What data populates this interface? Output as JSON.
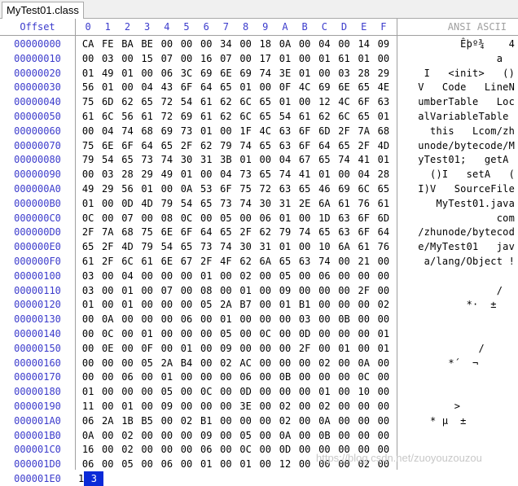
{
  "tab": {
    "title": "MyTest01.class"
  },
  "header": {
    "offset_label": "Offset",
    "columns": [
      "0",
      "1",
      "2",
      "3",
      "4",
      "5",
      "6",
      "7",
      "8",
      "9",
      "A",
      "B",
      "C",
      "D",
      "E",
      "F"
    ],
    "ansi_label": "ANSI ASCII"
  },
  "rows": [
    {
      "offset": "00000000",
      "bytes": [
        "CA",
        "FE",
        "BA",
        "BE",
        "00",
        "00",
        "00",
        "34",
        "00",
        "18",
        "0A",
        "00",
        "04",
        "00",
        "14",
        "09"
      ],
      "ansi": "Êþº¾    4"
    },
    {
      "offset": "00000010",
      "bytes": [
        "00",
        "03",
        "00",
        "15",
        "07",
        "00",
        "16",
        "07",
        "00",
        "17",
        "01",
        "00",
        "01",
        "61",
        "01",
        "00"
      ],
      "ansi": "a  "
    },
    {
      "offset": "00000020",
      "bytes": [
        "01",
        "49",
        "01",
        "00",
        "06",
        "3C",
        "69",
        "6E",
        "69",
        "74",
        "3E",
        "01",
        "00",
        "03",
        "28",
        "29"
      ],
      "ansi": "I   <init>   ()"
    },
    {
      "offset": "00000030",
      "bytes": [
        "56",
        "01",
        "00",
        "04",
        "43",
        "6F",
        "64",
        "65",
        "01",
        "00",
        "0F",
        "4C",
        "69",
        "6E",
        "65",
        "4E"
      ],
      "ansi": "V   Code   LineN"
    },
    {
      "offset": "00000040",
      "bytes": [
        "75",
        "6D",
        "62",
        "65",
        "72",
        "54",
        "61",
        "62",
        "6C",
        "65",
        "01",
        "00",
        "12",
        "4C",
        "6F",
        "63"
      ],
      "ansi": "umberTable   Loc"
    },
    {
      "offset": "00000050",
      "bytes": [
        "61",
        "6C",
        "56",
        "61",
        "72",
        "69",
        "61",
        "62",
        "6C",
        "65",
        "54",
        "61",
        "62",
        "6C",
        "65",
        "01"
      ],
      "ansi": "alVariableTable "
    },
    {
      "offset": "00000060",
      "bytes": [
        "00",
        "04",
        "74",
        "68",
        "69",
        "73",
        "01",
        "00",
        "1F",
        "4C",
        "63",
        "6F",
        "6D",
        "2F",
        "7A",
        "68"
      ],
      "ansi": "this   Lcom/zh"
    },
    {
      "offset": "00000070",
      "bytes": [
        "75",
        "6E",
        "6F",
        "64",
        "65",
        "2F",
        "62",
        "79",
        "74",
        "65",
        "63",
        "6F",
        "64",
        "65",
        "2F",
        "4D"
      ],
      "ansi": "unode/bytecode/M"
    },
    {
      "offset": "00000080",
      "bytes": [
        "79",
        "54",
        "65",
        "73",
        "74",
        "30",
        "31",
        "3B",
        "01",
        "00",
        "04",
        "67",
        "65",
        "74",
        "41",
        "01"
      ],
      "ansi": "yTest01;   getA "
    },
    {
      "offset": "00000090",
      "bytes": [
        "00",
        "03",
        "28",
        "29",
        "49",
        "01",
        "00",
        "04",
        "73",
        "65",
        "74",
        "41",
        "01",
        "00",
        "04",
        "28"
      ],
      "ansi": "()I   setA   ("
    },
    {
      "offset": "000000A0",
      "bytes": [
        "49",
        "29",
        "56",
        "01",
        "00",
        "0A",
        "53",
        "6F",
        "75",
        "72",
        "63",
        "65",
        "46",
        "69",
        "6C",
        "65"
      ],
      "ansi": "I)V   SourceFile"
    },
    {
      "offset": "000000B0",
      "bytes": [
        "01",
        "00",
        "0D",
        "4D",
        "79",
        "54",
        "65",
        "73",
        "74",
        "30",
        "31",
        "2E",
        "6A",
        "61",
        "76",
        "61"
      ],
      "ansi": "MyTest01.java"
    },
    {
      "offset": "000000C0",
      "bytes": [
        "0C",
        "00",
        "07",
        "00",
        "08",
        "0C",
        "00",
        "05",
        "00",
        "06",
        "01",
        "00",
        "1D",
        "63",
        "6F",
        "6D"
      ],
      "ansi": "com"
    },
    {
      "offset": "000000D0",
      "bytes": [
        "2F",
        "7A",
        "68",
        "75",
        "6E",
        "6F",
        "64",
        "65",
        "2F",
        "62",
        "79",
        "74",
        "65",
        "63",
        "6F",
        "64"
      ],
      "ansi": "/zhunode/bytecod"
    },
    {
      "offset": "000000E0",
      "bytes": [
        "65",
        "2F",
        "4D",
        "79",
        "54",
        "65",
        "73",
        "74",
        "30",
        "31",
        "01",
        "00",
        "10",
        "6A",
        "61",
        "76"
      ],
      "ansi": "e/MyTest01   jav"
    },
    {
      "offset": "000000F0",
      "bytes": [
        "61",
        "2F",
        "6C",
        "61",
        "6E",
        "67",
        "2F",
        "4F",
        "62",
        "6A",
        "65",
        "63",
        "74",
        "00",
        "21",
        "00"
      ],
      "ansi": "a/lang/Object !"
    },
    {
      "offset": "00000100",
      "bytes": [
        "03",
        "00",
        "04",
        "00",
        "00",
        "00",
        "01",
        "00",
        "02",
        "00",
        "05",
        "00",
        "06",
        "00",
        "00",
        "00"
      ],
      "ansi": ""
    },
    {
      "offset": "00000110",
      "bytes": [
        "03",
        "00",
        "01",
        "00",
        "07",
        "00",
        "08",
        "00",
        "01",
        "00",
        "09",
        "00",
        "00",
        "00",
        "2F",
        "00"
      ],
      "ansi": "/  "
    },
    {
      "offset": "00000120",
      "bytes": [
        "01",
        "00",
        "01",
        "00",
        "00",
        "00",
        "05",
        "2A",
        "B7",
        "00",
        "01",
        "B1",
        "00",
        "00",
        "00",
        "02"
      ],
      "ansi": "*·  ±   "
    },
    {
      "offset": "00000130",
      "bytes": [
        "00",
        "0A",
        "00",
        "00",
        "00",
        "06",
        "00",
        "01",
        "00",
        "00",
        "00",
        "03",
        "00",
        "0B",
        "00",
        "00"
      ],
      "ansi": ""
    },
    {
      "offset": "00000140",
      "bytes": [
        "00",
        "0C",
        "00",
        "01",
        "00",
        "00",
        "00",
        "05",
        "00",
        "0C",
        "00",
        "0D",
        "00",
        "00",
        "00",
        "01"
      ],
      "ansi": ""
    },
    {
      "offset": "00000150",
      "bytes": [
        "00",
        "0E",
        "00",
        "0F",
        "00",
        "01",
        "00",
        "09",
        "00",
        "00",
        "00",
        "2F",
        "00",
        "01",
        "00",
        "01"
      ],
      "ansi": "/     "
    },
    {
      "offset": "00000160",
      "bytes": [
        "00",
        "00",
        "00",
        "05",
        "2A",
        "B4",
        "00",
        "02",
        "AC",
        "00",
        "00",
        "00",
        "02",
        "00",
        "0A",
        "00"
      ],
      "ansi": "*´  ¬      "
    },
    {
      "offset": "00000170",
      "bytes": [
        "00",
        "00",
        "06",
        "00",
        "01",
        "00",
        "00",
        "00",
        "06",
        "00",
        "0B",
        "00",
        "00",
        "00",
        "0C",
        "00"
      ],
      "ansi": ""
    },
    {
      "offset": "00000180",
      "bytes": [
        "01",
        "00",
        "00",
        "00",
        "05",
        "00",
        "0C",
        "00",
        "0D",
        "00",
        "00",
        "00",
        "01",
        "00",
        "10",
        "00"
      ],
      "ansi": ""
    },
    {
      "offset": "00000190",
      "bytes": [
        "11",
        "00",
        "01",
        "00",
        "09",
        "00",
        "00",
        "00",
        "3E",
        "00",
        "02",
        "00",
        "02",
        "00",
        "00",
        "00"
      ],
      "ansi": ">         "
    },
    {
      "offset": "000001A0",
      "bytes": [
        "06",
        "2A",
        "1B",
        "B5",
        "00",
        "02",
        "B1",
        "00",
        "00",
        "00",
        "02",
        "00",
        "0A",
        "00",
        "00",
        "00"
      ],
      "ansi": "* µ  ±        "
    },
    {
      "offset": "000001B0",
      "bytes": [
        "0A",
        "00",
        "02",
        "00",
        "00",
        "00",
        "09",
        "00",
        "05",
        "00",
        "0A",
        "00",
        "0B",
        "00",
        "00",
        "00"
      ],
      "ansi": ""
    },
    {
      "offset": "000001C0",
      "bytes": [
        "16",
        "00",
        "02",
        "00",
        "00",
        "00",
        "06",
        "00",
        "0C",
        "00",
        "0D",
        "00",
        "00",
        "00",
        "00",
        "00"
      ],
      "ansi": ""
    },
    {
      "offset": "000001D0",
      "bytes": [
        "06",
        "00",
        "05",
        "00",
        "06",
        "00",
        "01",
        "00",
        "01",
        "00",
        "12",
        "00",
        "00",
        "00",
        "02",
        "00"
      ],
      "ansi": ""
    },
    {
      "offset": "000001E0",
      "bytes": [
        "13"
      ],
      "ansi": ""
    }
  ],
  "watermark": "https://blog.csdn.net/zuoyouzouzou",
  "colors": {
    "offset": "#3c3ccc",
    "cursor": "#0a2ad8",
    "grid": "#a0a0a0"
  }
}
